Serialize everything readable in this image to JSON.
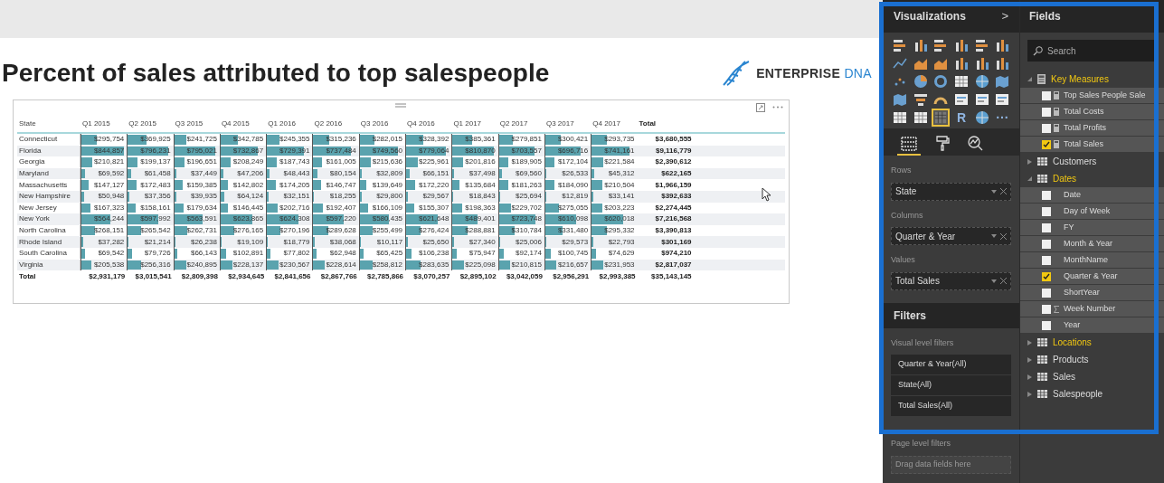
{
  "title": "Percent of sales attributed to top salespeople",
  "logo": {
    "text": "ENTERPRISE",
    "accent": "DNA"
  },
  "matrix": {
    "columns": [
      "State",
      "Q1 2015",
      "Q2 2015",
      "Q3 2015",
      "Q4 2015",
      "Q1 2016",
      "Q2 2016",
      "Q3 2016",
      "Q4 2016",
      "Q1 2017",
      "Q2 2017",
      "Q3 2017",
      "Q4 2017",
      "Total"
    ],
    "rows": [
      {
        "state": "Connecticut",
        "cells": [
          {
            "v": "$295,754",
            "level": 0.35
          },
          {
            "v": "$369,925",
            "level": 0.44
          },
          {
            "v": "$241,725",
            "level": 0.28
          },
          {
            "v": "$342,785",
            "level": 0.4
          },
          {
            "v": "$245,355",
            "level": 0.29
          },
          {
            "v": "$315,236",
            "level": 0.37
          },
          {
            "v": "$282,015",
            "level": 0.33
          },
          {
            "v": "$328,392",
            "level": 0.39
          },
          {
            "v": "$385,361",
            "level": 0.45
          },
          {
            "v": "$279,851",
            "level": 0.33
          },
          {
            "v": "$300,421",
            "level": 0.35
          },
          {
            "v": "$293,735",
            "level": 0.35
          }
        ],
        "total": "$3,680,555"
      },
      {
        "state": "Florida",
        "cells": [
          {
            "v": "$844,857",
            "level": 0.99
          },
          {
            "v": "$796,231",
            "level": 0.94
          },
          {
            "v": "$795,021",
            "level": 0.94
          },
          {
            "v": "$732,867",
            "level": 0.86
          },
          {
            "v": "$729,391",
            "level": 0.86
          },
          {
            "v": "$737,484",
            "level": 0.87
          },
          {
            "v": "$749,560",
            "level": 0.88
          },
          {
            "v": "$779,064",
            "level": 0.92
          },
          {
            "v": "$810,870",
            "level": 0.95
          },
          {
            "v": "$703,557",
            "level": 0.83
          },
          {
            "v": "$696,716",
            "level": 0.82
          },
          {
            "v": "$741,161",
            "level": 0.87
          }
        ],
        "total": "$9,116,779"
      },
      {
        "state": "Georgia",
        "cells": [
          {
            "v": "$210,821",
            "level": 0.25
          },
          {
            "v": "$199,137",
            "level": 0.23
          },
          {
            "v": "$196,651",
            "level": 0.23
          },
          {
            "v": "$208,249",
            "level": 0.24
          },
          {
            "v": "$187,743",
            "level": 0.22
          },
          {
            "v": "$161,005",
            "level": 0.19
          },
          {
            "v": "$215,636",
            "level": 0.25
          },
          {
            "v": "$225,961",
            "level": 0.27
          },
          {
            "v": "$201,816",
            "level": 0.24
          },
          {
            "v": "$189,905",
            "level": 0.22
          },
          {
            "v": "$172,104",
            "level": 0.2
          },
          {
            "v": "$221,584",
            "level": 0.26
          }
        ],
        "total": "$2,390,612"
      },
      {
        "state": "Maryland",
        "cells": [
          {
            "v": "$69,592",
            "level": 0.08
          },
          {
            "v": "$61,458",
            "level": 0.07
          },
          {
            "v": "$37,449",
            "level": 0.04
          },
          {
            "v": "$47,206",
            "level": 0.06
          },
          {
            "v": "$48,443",
            "level": 0.06
          },
          {
            "v": "$80,154",
            "level": 0.09
          },
          {
            "v": "$32,809",
            "level": 0.04
          },
          {
            "v": "$66,151",
            "level": 0.08
          },
          {
            "v": "$37,498",
            "level": 0.04
          },
          {
            "v": "$69,560",
            "level": 0.08
          },
          {
            "v": "$26,533",
            "level": 0.03
          },
          {
            "v": "$45,312",
            "level": 0.05
          }
        ],
        "total": "$622,165"
      },
      {
        "state": "Massachusetts",
        "cells": [
          {
            "v": "$147,127",
            "level": 0.17
          },
          {
            "v": "$172,483",
            "level": 0.2
          },
          {
            "v": "$159,385",
            "level": 0.19
          },
          {
            "v": "$142,802",
            "level": 0.17
          },
          {
            "v": "$174,205",
            "level": 0.2
          },
          {
            "v": "$146,747",
            "level": 0.17
          },
          {
            "v": "$139,649",
            "level": 0.16
          },
          {
            "v": "$172,220",
            "level": 0.2
          },
          {
            "v": "$135,684",
            "level": 0.16
          },
          {
            "v": "$181,263",
            "level": 0.21
          },
          {
            "v": "$184,090",
            "level": 0.22
          },
          {
            "v": "$210,504",
            "level": 0.25
          }
        ],
        "total": "$1,966,159"
      },
      {
        "state": "New Hampshire",
        "cells": [
          {
            "v": "$50,948",
            "level": 0.06
          },
          {
            "v": "$37,356",
            "level": 0.04
          },
          {
            "v": "$39,935",
            "level": 0.05
          },
          {
            "v": "$64,124",
            "level": 0.08
          },
          {
            "v": "$32,151",
            "level": 0.04
          },
          {
            "v": "$18,255",
            "level": 0.02
          },
          {
            "v": "$29,800",
            "level": 0.04
          },
          {
            "v": "$29,567",
            "level": 0.03
          },
          {
            "v": "$18,843",
            "level": 0.02
          },
          {
            "v": "$25,694",
            "level": 0.03
          },
          {
            "v": "$12,819",
            "level": 0.02
          },
          {
            "v": "$33,141",
            "level": 0.04
          }
        ],
        "total": "$392,633"
      },
      {
        "state": "New Jersey",
        "cells": [
          {
            "v": "$167,323",
            "level": 0.2
          },
          {
            "v": "$158,161",
            "level": 0.19
          },
          {
            "v": "$179,634",
            "level": 0.21
          },
          {
            "v": "$146,445",
            "level": 0.17
          },
          {
            "v": "$202,716",
            "level": 0.24
          },
          {
            "v": "$192,407",
            "level": 0.23
          },
          {
            "v": "$166,109",
            "level": 0.2
          },
          {
            "v": "$155,307",
            "level": 0.18
          },
          {
            "v": "$198,363",
            "level": 0.23
          },
          {
            "v": "$229,702",
            "level": 0.27
          },
          {
            "v": "$275,055",
            "level": 0.32
          },
          {
            "v": "$203,223",
            "level": 0.24
          }
        ],
        "total": "$2,274,445"
      },
      {
        "state": "New York",
        "cells": [
          {
            "v": "$564,244",
            "level": 0.66
          },
          {
            "v": "$597,992",
            "level": 0.7
          },
          {
            "v": "$563,591",
            "level": 0.66
          },
          {
            "v": "$623,865",
            "level": 0.73
          },
          {
            "v": "$624,308",
            "level": 0.73
          },
          {
            "v": "$597,220",
            "level": 0.7
          },
          {
            "v": "$580,435",
            "level": 0.68
          },
          {
            "v": "$621,648",
            "level": 0.73
          },
          {
            "v": "$489,401",
            "level": 0.58
          },
          {
            "v": "$723,748",
            "level": 0.85
          },
          {
            "v": "$610,098",
            "level": 0.72
          },
          {
            "v": "$620,018",
            "level": 0.73
          }
        ],
        "total": "$7,216,568"
      },
      {
        "state": "North Carolina",
        "cells": [
          {
            "v": "$268,151",
            "level": 0.32
          },
          {
            "v": "$265,542",
            "level": 0.31
          },
          {
            "v": "$262,731",
            "level": 0.31
          },
          {
            "v": "$276,165",
            "level": 0.32
          },
          {
            "v": "$270,196",
            "level": 0.32
          },
          {
            "v": "$289,628",
            "level": 0.34
          },
          {
            "v": "$255,499",
            "level": 0.3
          },
          {
            "v": "$276,424",
            "level": 0.33
          },
          {
            "v": "$288,881",
            "level": 0.34
          },
          {
            "v": "$310,784",
            "level": 0.37
          },
          {
            "v": "$331,480",
            "level": 0.39
          },
          {
            "v": "$295,332",
            "level": 0.35
          }
        ],
        "total": "$3,390,813"
      },
      {
        "state": "Rhode Island",
        "cells": [
          {
            "v": "$37,282",
            "level": 0.04
          },
          {
            "v": "$21,214",
            "level": 0.02
          },
          {
            "v": "$26,238",
            "level": 0.03
          },
          {
            "v": "$19,109",
            "level": 0.02
          },
          {
            "v": "$18,779",
            "level": 0.02
          },
          {
            "v": "$38,068",
            "level": 0.04
          },
          {
            "v": "$10,117",
            "level": 0.01
          },
          {
            "v": "$25,650",
            "level": 0.03
          },
          {
            "v": "$27,340",
            "level": 0.03
          },
          {
            "v": "$25,006",
            "level": 0.03
          },
          {
            "v": "$29,573",
            "level": 0.03
          },
          {
            "v": "$22,793",
            "level": 0.03
          }
        ],
        "total": "$301,169"
      },
      {
        "state": "South Carolina",
        "cells": [
          {
            "v": "$69,542",
            "level": 0.08
          },
          {
            "v": "$79,726",
            "level": 0.09
          },
          {
            "v": "$66,143",
            "level": 0.08
          },
          {
            "v": "$102,891",
            "level": 0.12
          },
          {
            "v": "$77,802",
            "level": 0.09
          },
          {
            "v": "$62,948",
            "level": 0.07
          },
          {
            "v": "$65,425",
            "level": 0.08
          },
          {
            "v": "$106,238",
            "level": 0.12
          },
          {
            "v": "$75,947",
            "level": 0.09
          },
          {
            "v": "$92,174",
            "level": 0.11
          },
          {
            "v": "$100,745",
            "level": 0.12
          },
          {
            "v": "$74,629",
            "level": 0.09
          }
        ],
        "total": "$974,210"
      },
      {
        "state": "Virginia",
        "cells": [
          {
            "v": "$205,538",
            "level": 0.24
          },
          {
            "v": "$256,316",
            "level": 0.3
          },
          {
            "v": "$240,895",
            "level": 0.28
          },
          {
            "v": "$228,137",
            "level": 0.27
          },
          {
            "v": "$230,567",
            "level": 0.27
          },
          {
            "v": "$228,614",
            "level": 0.27
          },
          {
            "v": "$258,812",
            "level": 0.3
          },
          {
            "v": "$283,635",
            "level": 0.33
          },
          {
            "v": "$225,098",
            "level": 0.26
          },
          {
            "v": "$210,815",
            "level": 0.25
          },
          {
            "v": "$216,657",
            "level": 0.25
          },
          {
            "v": "$231,953",
            "level": 0.27
          }
        ],
        "total": "$2,817,037"
      }
    ],
    "totals": {
      "label": "Total",
      "cells": [
        "$2,931,179",
        "$3,015,541",
        "$2,809,398",
        "$2,934,645",
        "$2,841,656",
        "$2,867,766",
        "$2,785,866",
        "$3,070,257",
        "$2,895,102",
        "$3,042,059",
        "$2,956,291",
        "$2,993,385"
      ],
      "total": "$35,143,145"
    }
  },
  "visualizations": {
    "title": "Visualizations",
    "chevron": ">",
    "icons": [
      {
        "kind": "hbar",
        "selected": false
      },
      {
        "kind": "vbar",
        "selected": false
      },
      {
        "kind": "hbar",
        "selected": false
      },
      {
        "kind": "vbar",
        "selected": false
      },
      {
        "kind": "hbar",
        "selected": false
      },
      {
        "kind": "vbar",
        "selected": false
      },
      {
        "kind": "line",
        "selected": false
      },
      {
        "kind": "area",
        "selected": false
      },
      {
        "kind": "area",
        "selected": false
      },
      {
        "kind": "vbar",
        "selected": false
      },
      {
        "kind": "vbar",
        "selected": false
      },
      {
        "kind": "vbar",
        "selected": false
      },
      {
        "kind": "scatter",
        "selected": false
      },
      {
        "kind": "pie",
        "selected": false
      },
      {
        "kind": "donut",
        "selected": false
      },
      {
        "kind": "table",
        "selected": false
      },
      {
        "kind": "globe",
        "selected": false
      },
      {
        "kind": "map",
        "selected": false
      },
      {
        "kind": "map",
        "selected": false
      },
      {
        "kind": "funnel",
        "selected": false
      },
      {
        "kind": "gauge",
        "selected": false
      },
      {
        "kind": "card",
        "selected": false
      },
      {
        "kind": "card",
        "selected": false
      },
      {
        "kind": "card",
        "selected": false
      },
      {
        "kind": "table",
        "selected": false
      },
      {
        "kind": "table",
        "selected": false
      },
      {
        "kind": "matrix",
        "selected": true
      },
      {
        "kind": "text",
        "text": "R",
        "selected": false
      },
      {
        "kind": "globe",
        "selected": false
      },
      {
        "kind": "text",
        "text": "···",
        "selected": false
      }
    ],
    "tabs": [
      {
        "kind": "fields",
        "selected": true
      },
      {
        "kind": "format",
        "selected": false
      },
      {
        "kind": "analytics",
        "selected": false
      }
    ],
    "wells": [
      {
        "label": "Rows",
        "value": "State"
      },
      {
        "label": "Columns",
        "value": "Quarter & Year"
      },
      {
        "label": "Values",
        "value": "Total Sales"
      }
    ]
  },
  "filters": {
    "title": "Filters",
    "visual_label": "Visual level filters",
    "visual": [
      "Quarter & Year(All)",
      "State(All)",
      "Total Sales(All)"
    ],
    "page_label": "Page level filters",
    "page_placeholder": "Drag data fields here"
  },
  "fields": {
    "title": "Fields",
    "search_placeholder": "Search",
    "tables": [
      {
        "name": "Key Measures",
        "kind": "measures",
        "expanded": true,
        "active": true,
        "children": [
          {
            "name": "Top Sales People Sale",
            "kind": "measure",
            "checked": false
          },
          {
            "name": "Total Costs",
            "kind": "measure",
            "checked": false
          },
          {
            "name": "Total Profits",
            "kind": "measure",
            "checked": false
          },
          {
            "name": "Total Sales",
            "kind": "measure",
            "checked": true
          }
        ]
      },
      {
        "name": "Customers",
        "kind": "table",
        "expanded": false,
        "active": false
      },
      {
        "name": "Dates",
        "kind": "table",
        "expanded": true,
        "active": true,
        "children": [
          {
            "name": "Date",
            "kind": "column",
            "checked": false
          },
          {
            "name": "Day of Week",
            "kind": "column",
            "checked": false
          },
          {
            "name": "FY",
            "kind": "column",
            "checked": false
          },
          {
            "name": "Month & Year",
            "kind": "column",
            "checked": false
          },
          {
            "name": "MonthName",
            "kind": "column",
            "checked": false
          },
          {
            "name": "Quarter & Year",
            "kind": "column",
            "checked": true
          },
          {
            "name": "ShortYear",
            "kind": "column",
            "checked": false
          },
          {
            "name": "Week Number",
            "kind": "sum",
            "checked": false
          },
          {
            "name": "Year",
            "kind": "column",
            "checked": false
          }
        ]
      },
      {
        "name": "Locations",
        "kind": "table",
        "expanded": false,
        "active": true
      },
      {
        "name": "Products",
        "kind": "table",
        "expanded": false,
        "active": false
      },
      {
        "name": "Sales",
        "kind": "table",
        "expanded": false,
        "active": false
      },
      {
        "name": "Salespeople",
        "kind": "table",
        "expanded": false,
        "active": false
      }
    ]
  }
}
